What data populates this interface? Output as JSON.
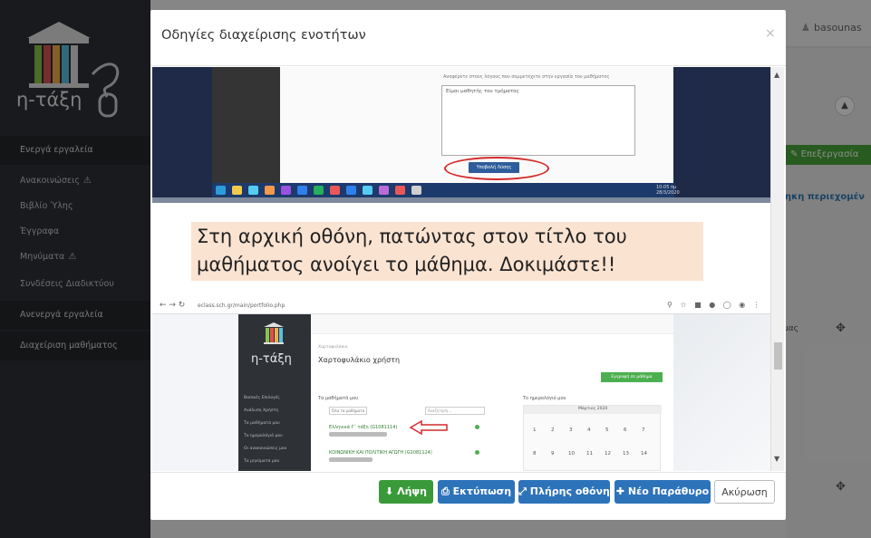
{
  "app": {
    "logo_text": "η-τάξη",
    "username": "basounas",
    "sidebar": {
      "active_tools": "Ενεργά εργαλεία",
      "items": [
        {
          "label": "Ανακοινώσεις",
          "warn": "⚠"
        },
        {
          "label": "Βιβλίο Ύλης"
        },
        {
          "label": "Έγγραφα"
        },
        {
          "label": "Μηνύματα",
          "warn": "⚠"
        },
        {
          "label": "Συνδέσεις Διαδικτύου"
        }
      ],
      "inactive_tools": "Ανενεργά εργαλεία",
      "course_admin": "Διαχείριση μαθήματος"
    },
    "edit_button": "Επεξεργασία",
    "content_title": "ηκη περιεχομέν",
    "partial_text": "μας"
  },
  "modal": {
    "title": "Οδηγίες διαχείρισης ενοτήτων",
    "close": "×",
    "buttons": {
      "download": "Λήψη",
      "print": "Εκτύπωση",
      "fullscreen": "Πλήρης οθόνη",
      "new_window": "Νέο Παράθυρο",
      "cancel": "Ακύρωση"
    }
  },
  "slide1": {
    "label": "Αναφέρετε στους λόγους που συμμετέχετε στην εργασία του μαθήματος",
    "textarea_text": "Είμαι μαθητής του τμήματος",
    "submit_label": "Υποβολή Λύσης",
    "clock": "10:05 πμ 28/3/2020"
  },
  "slide2": {
    "caption_line1": "Στη αρχική οθόνη, πατώντας στον τίτλο του",
    "caption_line2": "μαθήματος ανοίγει το μάθημα. Δοκιμάστε!!",
    "browser": {
      "url": "eclass.sch.gr/main/portfolio.php",
      "logo": "η-τάξη",
      "breadcrumb": "Χαρτοφυλάκιο",
      "title": "Χαρτοφυλάκιο χρήστη",
      "register_button": "Εγγραφή σε μάθημα",
      "my_courses": "Τα μαθήματά μου",
      "my_calendar": "Το ημερολόγιό μου",
      "filter": "Όλα τα μαθήματα",
      "search": "Αναζήτηση...",
      "course1": "Ελληνικά Γ΄ τάξη (G1081114)",
      "course2": "ΚΟΙΝΩΝΙΚΗ ΚΑΙ ΠΟΛΙΤΙΚΗ ΑΓΩΓΗ (G1081124)",
      "calendar_month": "Μάρτιος 2020",
      "sidebar_items": [
        "Βασικές Επιλογές",
        "Ανάλυση Χρήστη",
        "Τα μαθήματά μου",
        "Το ημερολόγιό μου",
        "Οι ανακοινώσεις μου",
        "Τα μηνύματά μου"
      ]
    }
  }
}
